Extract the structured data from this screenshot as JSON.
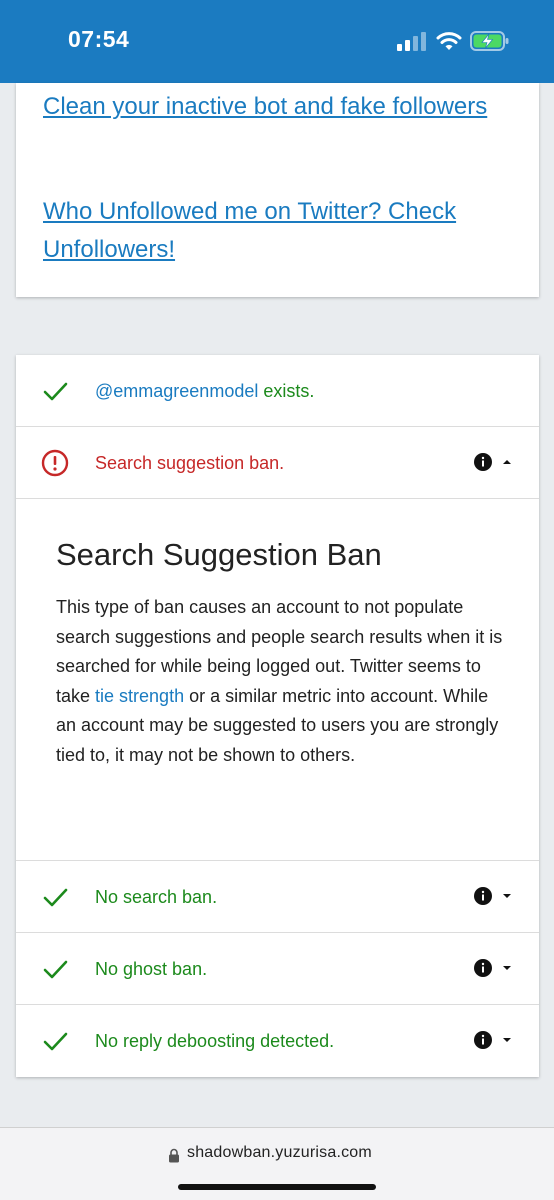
{
  "status_bar": {
    "time": "07:54",
    "bg_color": "#1b7bc1"
  },
  "links": [
    {
      "text": "Clean your inactive bot and fake followers"
    },
    {
      "text": "Who Unfollowed me on Twitter? Check Unfollowers!"
    }
  ],
  "results": {
    "exists": {
      "handle": "@emmagreenmodel",
      "suffix": " exists.",
      "icon": "check-icon"
    },
    "suggestion": {
      "text": "Search suggestion ban.",
      "icon": "alert-circle-icon",
      "expanded": true
    },
    "detail": {
      "title": "Search Suggestion Ban",
      "body_part1": "This type of ban causes an account to not populate search suggestions and people search results when it is searched for while being logged out. Twitter seems to take ",
      "link_text": "tie strength",
      "body_part2": " or a similar metric into account. While an account may be suggested to users you are strongly tied to, it may not be shown to others."
    },
    "search": {
      "text": "No search ban.",
      "icon": "check-icon"
    },
    "ghost": {
      "text": "No ghost ban.",
      "icon": "check-icon"
    },
    "reply": {
      "text": "No reply deboosting detected.",
      "icon": "check-icon"
    }
  },
  "colors": {
    "ok": "#1c8a1c",
    "bad": "#c62828",
    "link": "#1a7bc0"
  },
  "browser": {
    "url": "shadowban.yuzurisa.com"
  }
}
